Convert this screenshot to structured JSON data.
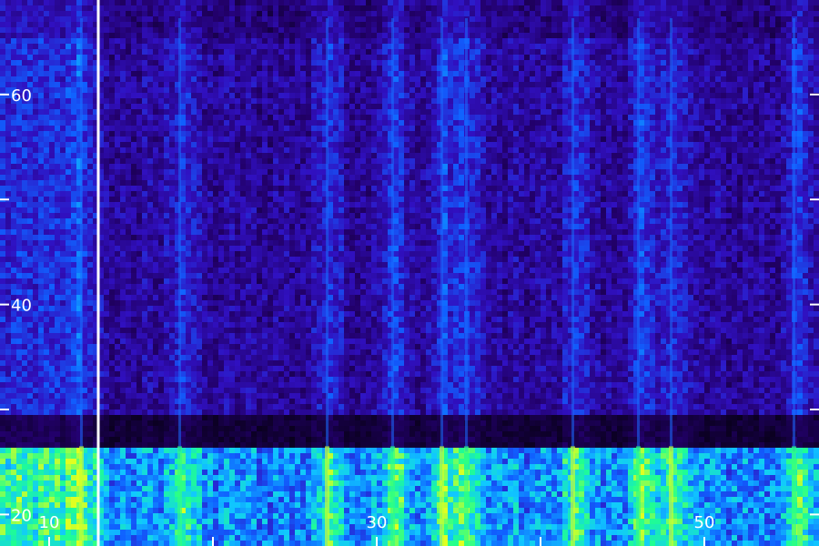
{
  "chart_data": {
    "type": "heatmap",
    "title": "",
    "xlabel": "",
    "ylabel": "",
    "xlim": [
      7,
      57
    ],
    "ylim": [
      17,
      69
    ],
    "x_tick_labels": [
      "10",
      "30",
      "50"
    ],
    "x_tick_values": [
      10,
      30,
      50
    ],
    "y_tick_labels": [
      "20",
      "40",
      "60"
    ],
    "y_tick_values": [
      20,
      40,
      60
    ],
    "y_minor_ticks": [
      30,
      50
    ],
    "x_minor_ticks": [
      20,
      40
    ],
    "cursor_x": 13,
    "grid": false,
    "colormap": [
      "#000000",
      "#22006a",
      "#3010c0",
      "#1060ff",
      "#10c8ff",
      "#20ff90",
      "#e0ff20"
    ],
    "low_band_top": 26,
    "dark_band_range": [
      26.5,
      30
    ],
    "bright_columns_x": [
      12,
      18,
      27,
      31,
      34,
      35.5,
      42,
      46,
      48,
      55.5
    ]
  }
}
